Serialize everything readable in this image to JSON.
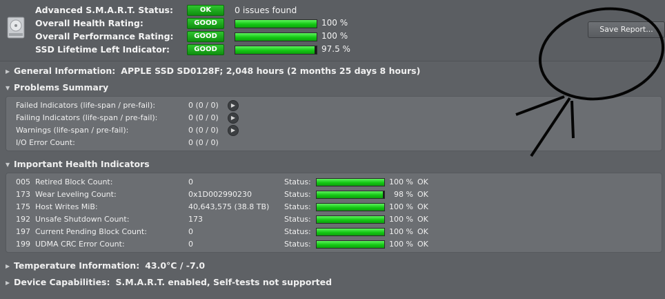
{
  "summary": {
    "rows": [
      {
        "label": "Advanced S.M.A.R.T. Status:",
        "badge": "OK",
        "value": "0 issues found"
      },
      {
        "label": "Overall Health Rating:",
        "badge": "GOOD",
        "percent": 100,
        "percent_text": "100 %"
      },
      {
        "label": "Overall Performance Rating:",
        "badge": "GOOD",
        "percent": 100,
        "percent_text": "100 %"
      },
      {
        "label": "SSD Lifetime Left Indicator:",
        "badge": "GOOD",
        "percent": 97.5,
        "percent_text": "97.5 %"
      }
    ],
    "save_report_label": "Save Report..."
  },
  "sections": {
    "general": {
      "title": "General Information:",
      "detail": "APPLE SSD SD0128F; 2,048 hours (2 months 25 days 8 hours)"
    },
    "problems": {
      "title": "Problems Summary"
    },
    "health": {
      "title": "Important Health Indicators"
    },
    "temperature": {
      "title": "Temperature Information:",
      "detail": "43.0°C / -7.0"
    },
    "capabilities": {
      "title": "Device Capabilities:",
      "detail": "S.M.A.R.T. enabled, Self-tests not supported"
    }
  },
  "problems": [
    {
      "label": "Failed Indicators (life-span / pre-fail):",
      "value": "0 (0 / 0)",
      "has_button": true
    },
    {
      "label": "Failing Indicators (life-span / pre-fail):",
      "value": "0 (0 / 0)",
      "has_button": true
    },
    {
      "label": "Warnings (life-span / pre-fail):",
      "value": "0 (0 / 0)",
      "has_button": true
    },
    {
      "label": "I/O Error Count:",
      "value": "0 (0 / 0)",
      "has_button": false
    }
  ],
  "health_indicators": [
    {
      "id": "005",
      "name": "Retired Block Count:",
      "value": "0",
      "status_label": "Status:",
      "percent": 100,
      "percent_text": "100 %",
      "status": "OK"
    },
    {
      "id": "173",
      "name": "Wear Leveling Count:",
      "value": "0x1D002990230",
      "status_label": "Status:",
      "percent": 98,
      "percent_text": "98 %",
      "status": "OK"
    },
    {
      "id": "175",
      "name": "Host Writes MiB:",
      "value": "40,643,575 (38.8 TB)",
      "status_label": "Status:",
      "percent": 100,
      "percent_text": "100 %",
      "status": "OK"
    },
    {
      "id": "192",
      "name": "Unsafe Shutdown Count:",
      "value": "173",
      "status_label": "Status:",
      "percent": 100,
      "percent_text": "100 %",
      "status": "OK"
    },
    {
      "id": "197",
      "name": "Current Pending Block Count:",
      "value": "0",
      "status_label": "Status:",
      "percent": 100,
      "percent_text": "100 %",
      "status": "OK"
    },
    {
      "id": "199",
      "name": "UDMA CRC Error Count:",
      "value": "0",
      "status_label": "Status:",
      "percent": 100,
      "percent_text": "100 %",
      "status": "OK"
    }
  ],
  "colors": {
    "good": "#14c814",
    "background": "#5e6165",
    "panel": "#6b6e72"
  },
  "icons": {
    "drive": "hard-drive-icon",
    "expand": "disclosure-triangle-icon",
    "go": "arrow-right-circle-icon"
  }
}
